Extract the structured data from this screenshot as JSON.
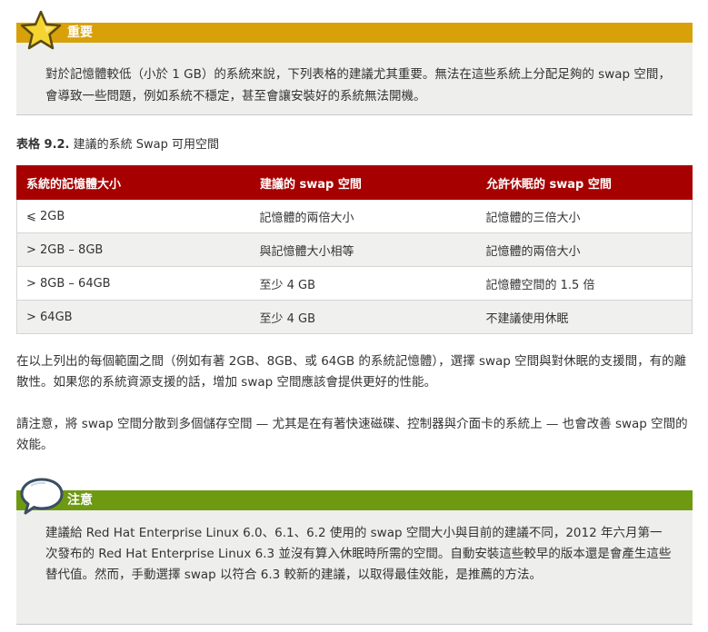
{
  "important": {
    "title": "重要",
    "text": "對於記憶體較低（小於 1 GB）的系統來說，下列表格的建議尤其重要。無法在這些系統上分配足夠的 swap 空間，會導致一些問題，例如系統不穩定，甚至會讓安裝好的系統無法開機。",
    "header_color": "#d8a10a",
    "icon": "star-icon"
  },
  "table": {
    "caption_label": "表格 9.2.",
    "caption_title": "建議的系統 Swap 可用空間",
    "header_color": "#a70000",
    "headers": [
      "系統的記憶體大小",
      "建議的 swap 空間",
      "允許休眠的 swap 空間"
    ],
    "rows": [
      [
        "⩽ 2GB",
        "記憶體的兩倍大小",
        "記憶體的三倍大小"
      ],
      [
        "> 2GB – 8GB",
        "與記憶體大小相等",
        "記憶體的兩倍大小"
      ],
      [
        "> 8GB – 64GB",
        "至少 4 GB",
        "記憶體空間的 1.5 倍"
      ],
      [
        "> 64GB",
        "至少 4 GB",
        "不建議使用休眠"
      ]
    ]
  },
  "paragraphs": [
    "在以上列出的每個範圍之間（例如有著 2GB、8GB、或 64GB 的系統記憶體），選擇 swap 空間與對休眠的支援間，有的離散性。如果您的系統資源支援的話，增加 swap 空間應該會提供更好的性能。",
    "請注意，將 swap 空間分散到多個儲存空間 — 尤其是在有著快速磁碟、控制器與介面卡的系統上 — 也會改善 swap 空間的效能。"
  ],
  "note": {
    "title": "注意",
    "text": "建議給 Red Hat Enterprise Linux 6.0、6.1、6.2 使用的 swap 空間大小與目前的建議不同，2012 年六月第一次發布的 Red Hat Enterprise Linux 6.3 並沒有算入休眠時所需的空間。自動安裝這些較早的版本還是會產生這些替代值。然而，手動選擇 swap 以符合 6.3 較新的建議，以取得最佳效能，是推薦的方法。",
    "header_color": "#6e9a12",
    "icon": "speech-bubble-icon"
  }
}
